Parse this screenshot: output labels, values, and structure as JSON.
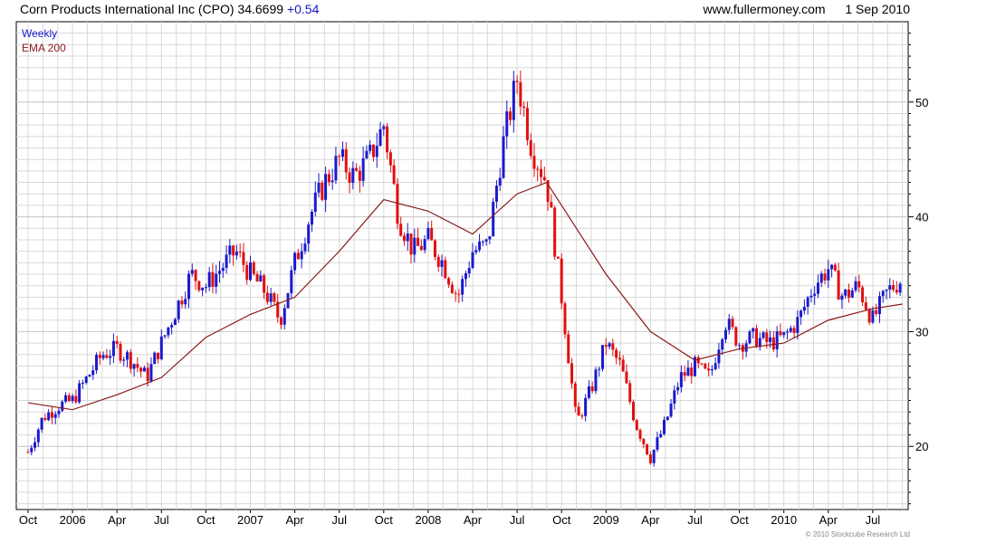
{
  "header": {
    "title": "Corn Products International Inc (CPO) 34.6699",
    "change": "+0.54",
    "website": "www.fullermoney.com",
    "date": "1 Sep 2010"
  },
  "legend": {
    "weekly": "Weekly",
    "ema": "EMA 200"
  },
  "copyright": "© 2010 Stockcube Research Ltd",
  "colors": {
    "up": "#1a1acc",
    "down": "#e01010",
    "ema": "#8b1a1a",
    "grid": "#d8d8d8"
  },
  "chart_data": {
    "type": "candlestick",
    "title": "Corn Products International Inc (CPO)",
    "x_ticks": [
      "Oct",
      "2006",
      "Apr",
      "Jul",
      "Oct",
      "2007",
      "Apr",
      "Jul",
      "Oct",
      "2008",
      "Apr",
      "Jul",
      "Oct",
      "2009",
      "Apr",
      "Jul",
      "Oct",
      "2010",
      "Apr",
      "Jul"
    ],
    "y_ticks": [
      20,
      30,
      40,
      50
    ],
    "ylim": [
      14.5,
      57
    ],
    "grid": true,
    "series": [
      {
        "name": "Weekly",
        "type": "candlestick",
        "values": [
          {
            "x": "Oct 2005",
            "y": 19.5
          },
          {
            "x": "Nov 2005",
            "y": 22.5
          },
          {
            "x": "Dec 2005",
            "y": 23.5
          },
          {
            "x": "Jan 2006",
            "y": 24
          },
          {
            "x": "Feb 2006",
            "y": 26
          },
          {
            "x": "Mar 2006",
            "y": 28
          },
          {
            "x": "Apr 2006",
            "y": 28.5
          },
          {
            "x": "May 2006",
            "y": 27.5
          },
          {
            "x": "Jun 2006",
            "y": 26
          },
          {
            "x": "Jul 2006",
            "y": 29
          },
          {
            "x": "Aug 2006",
            "y": 32
          },
          {
            "x": "Sep 2006",
            "y": 35
          },
          {
            "x": "Oct 2006",
            "y": 34
          },
          {
            "x": "Nov 2006",
            "y": 35.5
          },
          {
            "x": "Dec 2006",
            "y": 37
          },
          {
            "x": "Jan 2007",
            "y": 35
          },
          {
            "x": "Feb 2007",
            "y": 33.5
          },
          {
            "x": "Mar 2007",
            "y": 31
          },
          {
            "x": "Apr 2007",
            "y": 36
          },
          {
            "x": "May 2007",
            "y": 40
          },
          {
            "x": "Jun 2007",
            "y": 43
          },
          {
            "x": "Jul 2007",
            "y": 45
          },
          {
            "x": "Aug 2007",
            "y": 43.5
          },
          {
            "x": "Sep 2007",
            "y": 45
          },
          {
            "x": "Oct 2007",
            "y": 48
          },
          {
            "x": "Nov 2007",
            "y": 40
          },
          {
            "x": "Dec 2007",
            "y": 37
          },
          {
            "x": "Jan 2008",
            "y": 38
          },
          {
            "x": "Feb 2008",
            "y": 36
          },
          {
            "x": "Mar 2008",
            "y": 33
          },
          {
            "x": "Apr 2008",
            "y": 37
          },
          {
            "x": "May 2008",
            "y": 37.5
          },
          {
            "x": "Jun 2008",
            "y": 46
          },
          {
            "x": "Jul 2008",
            "y": 52
          },
          {
            "x": "Aug 2008",
            "y": 46
          },
          {
            "x": "Sep 2008",
            "y": 43
          },
          {
            "x": "Oct 2008",
            "y": 33
          },
          {
            "x": "Nov 2008",
            "y": 22
          },
          {
            "x": "Dec 2008",
            "y": 25
          },
          {
            "x": "Jan 2009",
            "y": 29
          },
          {
            "x": "Feb 2009",
            "y": 27
          },
          {
            "x": "Mar 2009",
            "y": 22
          },
          {
            "x": "Apr 2009",
            "y": 19
          },
          {
            "x": "May 2009",
            "y": 22
          },
          {
            "x": "Jun 2009",
            "y": 26
          },
          {
            "x": "Jul 2009",
            "y": 27
          },
          {
            "x": "Aug 2009",
            "y": 26
          },
          {
            "x": "Sep 2009",
            "y": 31
          },
          {
            "x": "Oct 2009",
            "y": 29
          },
          {
            "x": "Nov 2009",
            "y": 29.5
          },
          {
            "x": "Dec 2009",
            "y": 29
          },
          {
            "x": "Jan 2010",
            "y": 29.5
          },
          {
            "x": "Feb 2010",
            "y": 31
          },
          {
            "x": "Mar 2010",
            "y": 34
          },
          {
            "x": "Apr 2010",
            "y": 35.5
          },
          {
            "x": "May 2010",
            "y": 33
          },
          {
            "x": "Jun 2010",
            "y": 34
          },
          {
            "x": "Jul 2010",
            "y": 31
          },
          {
            "x": "Aug 2010",
            "y": 33.5
          },
          {
            "x": "Sep 2010",
            "y": 34.67
          }
        ]
      },
      {
        "name": "EMA 200",
        "type": "line",
        "values": [
          {
            "x": "Oct 2005",
            "y": 23.8
          },
          {
            "x": "Jan 2006",
            "y": 23.2
          },
          {
            "x": "Apr 2006",
            "y": 24.5
          },
          {
            "x": "Jul 2006",
            "y": 26
          },
          {
            "x": "Oct 2006",
            "y": 29.5
          },
          {
            "x": "Jan 2007",
            "y": 31.5
          },
          {
            "x": "Apr 2007",
            "y": 33
          },
          {
            "x": "Jul 2007",
            "y": 37
          },
          {
            "x": "Oct 2007",
            "y": 41.5
          },
          {
            "x": "Jan 2008",
            "y": 40.5
          },
          {
            "x": "Apr 2008",
            "y": 38.5
          },
          {
            "x": "Jul 2008",
            "y": 42
          },
          {
            "x": "Sep 2008",
            "y": 43
          },
          {
            "x": "Nov 2008",
            "y": 39
          },
          {
            "x": "Jan 2009",
            "y": 35
          },
          {
            "x": "Apr 2009",
            "y": 30
          },
          {
            "x": "Jul 2009",
            "y": 27.5
          },
          {
            "x": "Oct 2009",
            "y": 28.5
          },
          {
            "x": "Jan 2010",
            "y": 29
          },
          {
            "x": "Apr 2010",
            "y": 31
          },
          {
            "x": "Jul 2010",
            "y": 32
          },
          {
            "x": "Sep 2010",
            "y": 32.4
          }
        ]
      }
    ]
  }
}
